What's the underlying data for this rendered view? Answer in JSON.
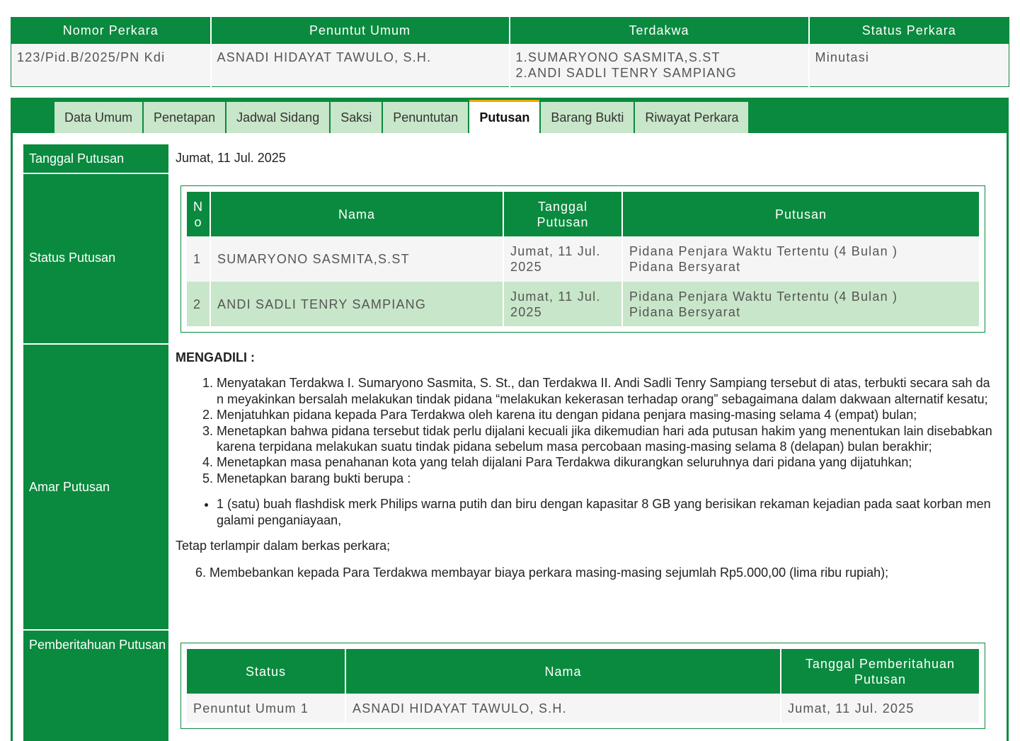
{
  "case_summary": {
    "headers": [
      "Nomor Perkara",
      "Penuntut Umum",
      "Terdakwa",
      "Status Perkara"
    ],
    "nomor_perkara": "123/Pid.B/2025/PN Kdi",
    "penuntut_umum": "ASNADI HIDAYAT TAWULO, S.H.",
    "terdakwa": [
      "1.SUMARYONO SASMITA,S.ST",
      "2.ANDI SADLI TENRY SAMPIANG"
    ],
    "status_perkara": "Minutasi"
  },
  "tabs": [
    "Data Umum",
    "Penetapan",
    "Jadwal Sidang",
    "Saksi",
    "Penuntutan",
    "Putusan",
    "Barang Bukti",
    "Riwayat Perkara"
  ],
  "active_tab": "Putusan",
  "labels": {
    "tanggal_putusan": "Tanggal Putusan",
    "status_putusan": "Status Putusan",
    "amar_putusan": "Amar Putusan",
    "pemberitahuan_putusan": "Pemberitahuan Putusan"
  },
  "tanggal_putusan": "Jumat, 11 Jul. 2025",
  "status_table": {
    "headers": [
      "No",
      "Nama",
      "Tanggal Putusan",
      "Putusan"
    ],
    "rows": [
      {
        "no": "1",
        "nama": "SUMARYONO SASMITA,S.ST",
        "tanggal": "Jumat, 11 Jul. 2025",
        "putusan_1": "Pidana Penjara Waktu Tertentu (4 Bulan )",
        "putusan_2": "Pidana Bersyarat"
      },
      {
        "no": "2",
        "nama": "ANDI SADLI TENRY SAMPIANG",
        "tanggal": "Jumat, 11 Jul. 2025",
        "putusan_1": "Pidana Penjara Waktu Tertentu (4 Bulan )",
        "putusan_2": "Pidana Bersyarat"
      }
    ]
  },
  "amar": {
    "heading": "MENGADILI :",
    "items": [
      "Menyatakan Terdakwa I. Sumaryono Sasmita, S. St., dan Terdakwa II. Andi Sadli Tenry Sampiang tersebut di atas, terbukti secara sah dan meyakinkan bersalah melakukan tindak pidana “melakukan kekerasan terhadap orang” sebagaimana dalam dakwaan alternatif kesatu;",
      "Menjatuhkan pidana kepada Para Terdakwa oleh karena itu dengan pidana penjara masing-masing selama 4 (empat) bulan;",
      "Menetapkan bahwa pidana tersebut tidak perlu dijalani kecuali jika dikemudian hari ada putusan hakim yang menentukan lain disebabkan karena terpidana melakukan suatu tindak pidana sebelum masa percobaan masing-masing selama 8 (delapan) bulan berakhir;",
      "Menetapkan masa penahanan kota yang telah dijalani Para Terdakwa dikurangkan seluruhnya dari pidana yang dijatuhkan;",
      "Menetapkan barang bukti berupa :"
    ],
    "bullet": "1 (satu) buah flashdisk merk Philips warna putih dan biru dengan kapasitar 8 GB yang berisikan rekaman kejadian pada saat korban mengalami penganiayaan,",
    "tetap": "Tetap terlampir dalam berkas perkara;",
    "item_six": "6. Membebankan kepada Para Terdakwa membayar biaya perkara masing-masing sejumlah Rp5.000,00 (lima ribu rupiah);"
  },
  "pemberitahuan_table": {
    "headers": [
      "Status",
      "Nama",
      "Tanggal Pemberitahuan Putusan"
    ],
    "rows": [
      {
        "status": "Penuntut Umum 1",
        "nama": "ASNADI HIDAYAT TAWULO, S.H.",
        "tanggal": "Jumat, 11 Jul. 2025"
      }
    ]
  }
}
